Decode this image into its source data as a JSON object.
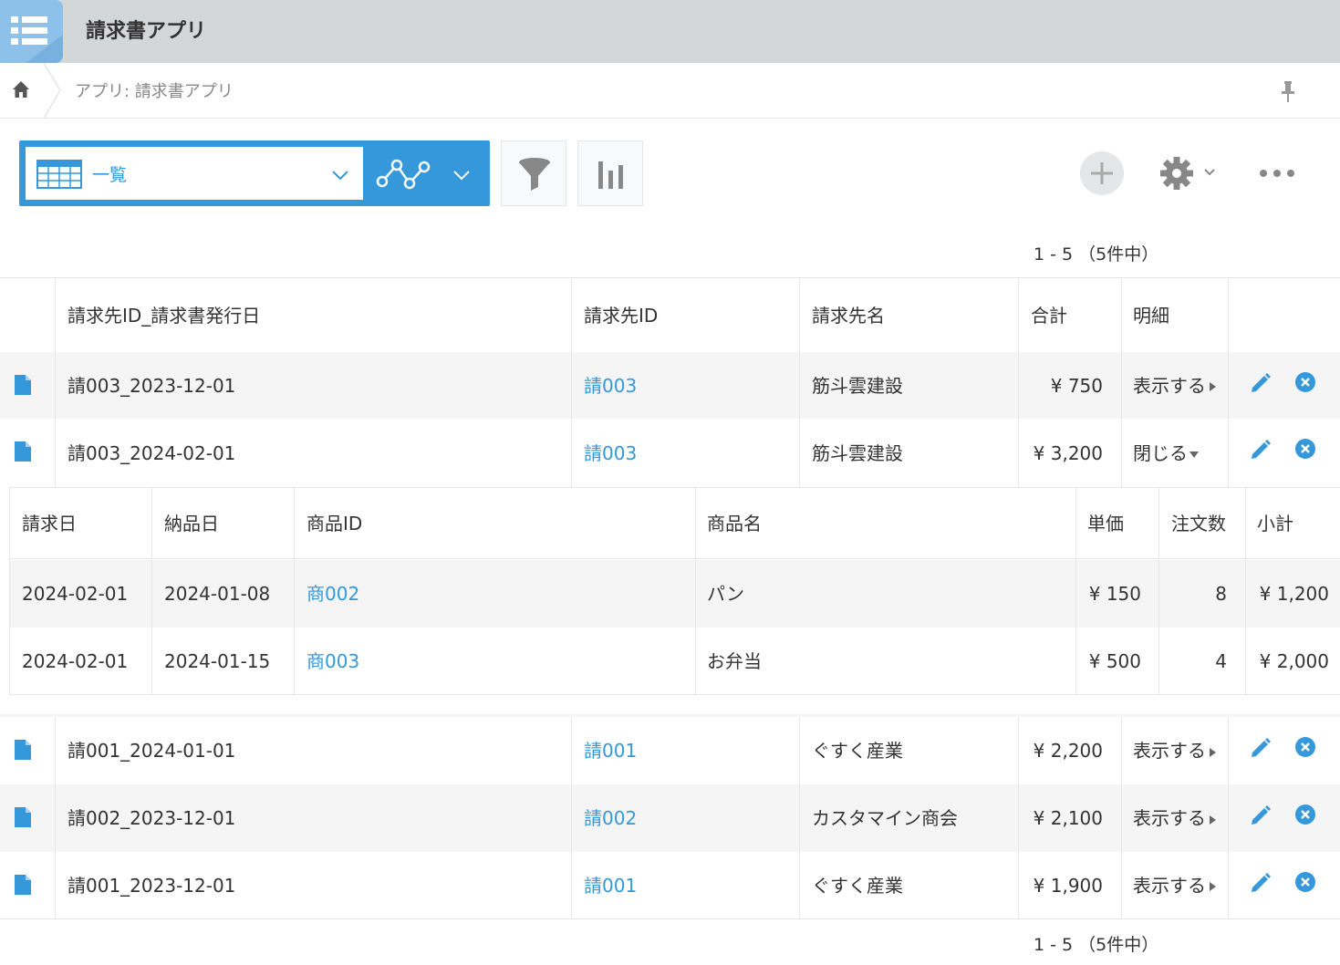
{
  "app": {
    "title": "請求書アプリ",
    "icon": "app-list-icon"
  },
  "breadcrumb": {
    "home_icon": "home-icon",
    "text": "アプリ: 請求書アプリ",
    "pin_icon": "pin-icon"
  },
  "toolbar": {
    "view_label": "一覧",
    "view_icon": "table-icon",
    "graph_icon": "graph-icon",
    "filter_icon": "funnel-icon",
    "chart_icon": "bar-chart-icon",
    "add_icon": "plus-icon",
    "settings_icon": "gear-icon",
    "more_icon": "ellipsis-icon",
    "accent": "#3498db"
  },
  "pager": {
    "top": "1 - 5 （5件中）",
    "bottom": "1 - 5 （5件中）"
  },
  "table": {
    "headers": [
      "請求先ID_請求書発行日",
      "請求先ID",
      "請求先名",
      "合計",
      "明細"
    ],
    "rows": [
      {
        "key": "請003_2023-12-01",
        "client_id": "請003",
        "client_name": "筋斗雲建設",
        "total": "¥ 750",
        "detail": "表示する"
      },
      {
        "key": "請003_2024-02-01",
        "client_id": "請003",
        "client_name": "筋斗雲建設",
        "total": "¥ 3,200",
        "detail": "閉じる"
      },
      {
        "key": "請001_2024-01-01",
        "client_id": "請001",
        "client_name": "ぐすく産業",
        "total": "¥ 2,200",
        "detail": "表示する"
      },
      {
        "key": "請002_2023-12-01",
        "client_id": "請002",
        "client_name": "カスタマイン商会",
        "total": "¥ 2,100",
        "detail": "表示する"
      },
      {
        "key": "請001_2023-12-01",
        "client_id": "請001",
        "client_name": "ぐすく産業",
        "total": "¥ 1,900",
        "detail": "表示する"
      }
    ]
  },
  "detail": {
    "headers": [
      "請求日",
      "納品日",
      "商品ID",
      "商品名",
      "単価",
      "注文数",
      "小計"
    ],
    "rows": [
      {
        "invoice_date": "2024-02-01",
        "delivery_date": "2024-01-08",
        "product_id": "商002",
        "product_name": "パン",
        "unit_price": "¥ 150",
        "qty": "8",
        "subtotal": "¥ 1,200"
      },
      {
        "invoice_date": "2024-02-01",
        "delivery_date": "2024-01-15",
        "product_id": "商003",
        "product_name": "お弁当",
        "unit_price": "¥ 500",
        "qty": "4",
        "subtotal": "¥ 2,000"
      }
    ]
  }
}
